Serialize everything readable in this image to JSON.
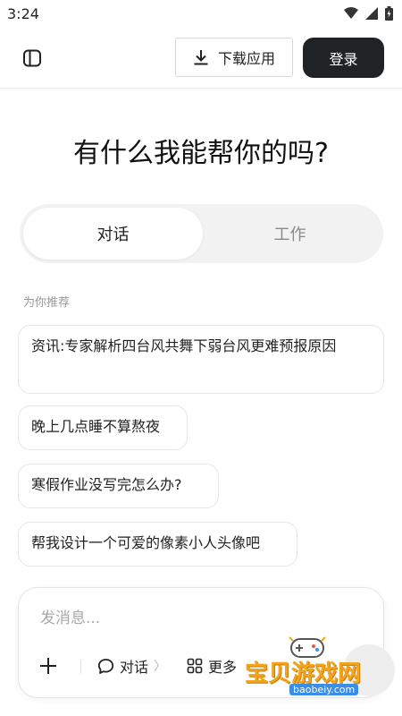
{
  "status_bar": {
    "time": "3:24"
  },
  "header": {
    "download_label": "下载应用",
    "login_label": "登录"
  },
  "hero": {
    "title": "有什么我能帮你的吗?"
  },
  "mode_switch": {
    "tabs": [
      {
        "label": "对话",
        "active": true
      },
      {
        "label": "工作",
        "active": false
      }
    ]
  },
  "recommend": {
    "label": "为你推荐",
    "items": [
      "资讯:专家解析四台风共舞下弱台风更难预报原因",
      "晚上几点睡不算熬夜",
      "寒假作业没写完怎么办?",
      "帮我设计一个可爱的像素小人头像吧"
    ]
  },
  "composer": {
    "placeholder": "发消息...",
    "chat_mode_label": "对话",
    "chat_mode_chevron": "〉",
    "more_label": "更多"
  },
  "watermark": {
    "text": "宝贝游戏网",
    "url": "baobeiy.com"
  },
  "colors": {
    "login_bg": "#1f2326",
    "watermark_text": "#f2a51a"
  }
}
